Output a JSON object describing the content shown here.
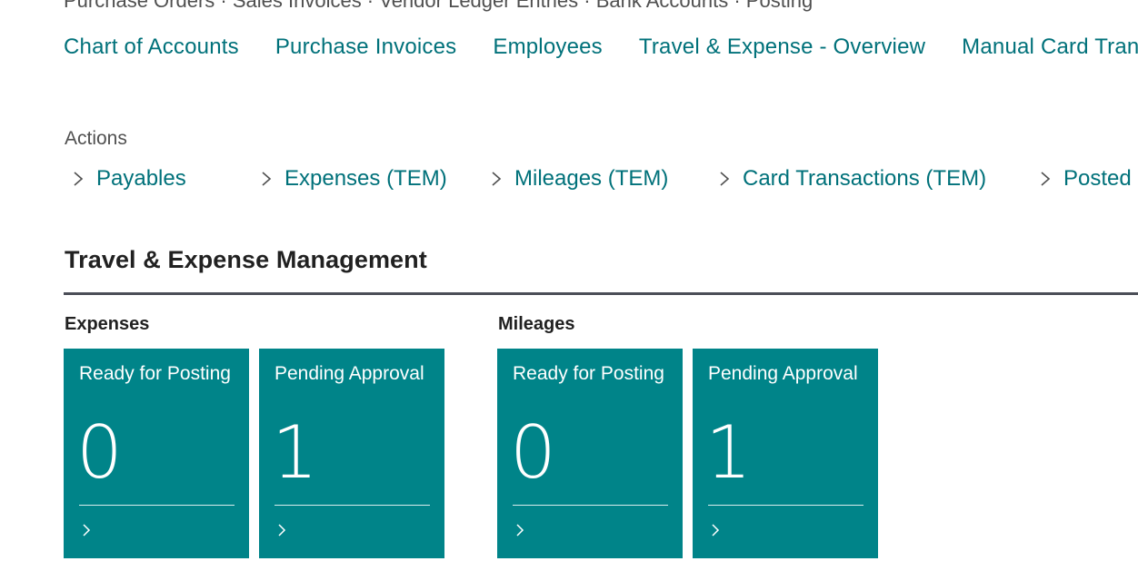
{
  "top_fragment": "Purchase Orders ·  Sales Invoices  ·  Vendor Ledger Entries  ·  Bank Accounts  ·  Posting",
  "top_nav": [
    {
      "label": "Chart of Accounts"
    },
    {
      "label": "Purchase Invoices"
    },
    {
      "label": "Employees"
    },
    {
      "label": "Travel & Expense - Overview"
    },
    {
      "label": "Manual Card Transactions"
    }
  ],
  "actions": {
    "label": "Actions",
    "items": [
      {
        "label": "Payables"
      },
      {
        "label": "Expenses (TEM)"
      },
      {
        "label": "Mileages (TEM)"
      },
      {
        "label": "Card Transactions (TEM)"
      },
      {
        "label": "Posted"
      }
    ]
  },
  "section": {
    "title": "Travel & Expense Management",
    "groups": [
      {
        "label": "Expenses",
        "tiles": [
          {
            "title": "Ready for Posting",
            "value": "0"
          },
          {
            "title": "Pending Approval",
            "value": "1"
          }
        ]
      },
      {
        "label": "Mileages",
        "tiles": [
          {
            "title": "Ready for Posting",
            "value": "0"
          },
          {
            "title": "Pending Approval",
            "value": "1"
          }
        ]
      }
    ]
  },
  "colors": {
    "link": "#00717a",
    "tile_background": "#008489",
    "tile_text": "#ffffff",
    "section_rule": "#4b4e57"
  },
  "icons": {
    "action_chevron": "chevron-right-icon",
    "tile_chevron": "chevron-right-icon"
  }
}
